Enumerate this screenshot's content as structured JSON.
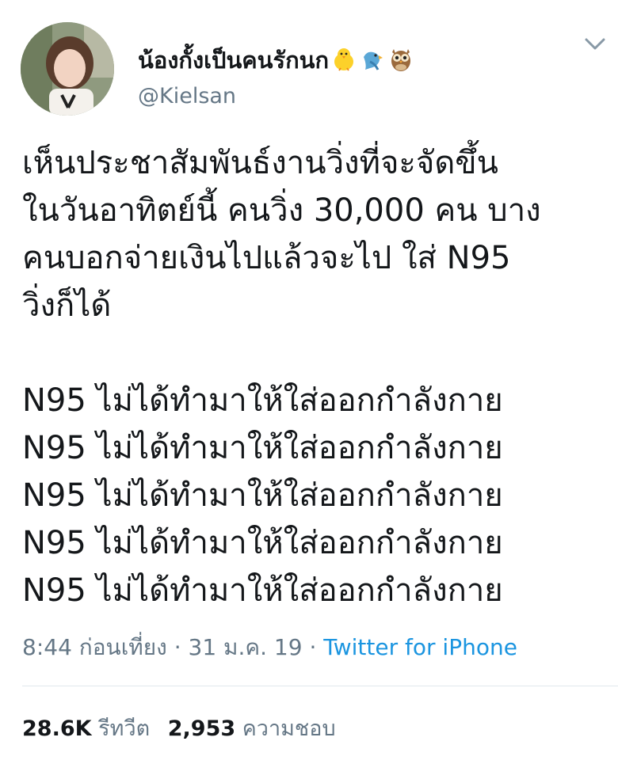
{
  "author": {
    "display_name": "น้องกั้งเป็นคนรักนก",
    "emojis": [
      "chick-emoji",
      "parrot-emoji",
      "owl-emoji"
    ],
    "handle": "@Kielsan"
  },
  "tweet": {
    "lines": [
      "เห็นประชาสัมพันธ์งานวิ่งที่จะจัดขึ้น",
      "ในวันอาทิตย์นี้ คนวิ่ง 30,000 คน บาง",
      "คนบอกจ่ายเงินไปแล้วจะไป ใส่ N95",
      "วิ่งก็ได้"
    ],
    "repeated_lines": [
      "N95 ไม่ได้ทำมาให้ใส่ออกกำลังกาย",
      "N95 ไม่ได้ทำมาให้ใส่ออกกำลังกาย",
      "N95 ไม่ได้ทำมาให้ใส่ออกกำลังกาย",
      "N95 ไม่ได้ทำมาให้ใส่ออกกำลังกาย",
      "N95 ไม่ได้ทำมาให้ใส่ออกกำลังกาย"
    ]
  },
  "meta": {
    "time": "8:44 ก่อนเที่ยง",
    "separator": "·",
    "date": "31 ม.ค. 19",
    "source": "Twitter for iPhone"
  },
  "stats": {
    "retweets_count": "28.6K",
    "retweets_label": "รีทวีต",
    "likes_count": "2,953",
    "likes_label": "ความชอบ"
  },
  "colors": {
    "text": "#14171a",
    "secondary": "#657786",
    "link": "#1b95e0",
    "divider": "#e1e8ed"
  }
}
